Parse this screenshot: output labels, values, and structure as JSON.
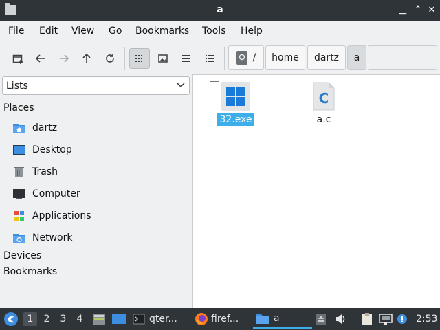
{
  "window": {
    "title": "a"
  },
  "menu": [
    "File",
    "Edit",
    "View",
    "Go",
    "Bookmarks",
    "Tools",
    "Help"
  ],
  "breadcrumb": {
    "root": "/",
    "items": [
      "home",
      "dartz",
      "a"
    ]
  },
  "sidebar": {
    "selector": "Lists",
    "places_header": "Places",
    "places": [
      "dartz",
      "Desktop",
      "Trash",
      "Computer",
      "Applications",
      "Network"
    ],
    "devices_header": "Devices",
    "bookmarks_header": "Bookmarks"
  },
  "files": [
    {
      "name": "32.exe",
      "icon": "windows-executable-icon",
      "selected": true
    },
    {
      "name": "a.c",
      "icon": "c-source-file-icon",
      "selected": false
    }
  ],
  "taskbar": {
    "workspaces": [
      "1",
      "2",
      "3",
      "4"
    ],
    "tasks": [
      {
        "label": "qter...",
        "icon": "terminal-icon"
      },
      {
        "label": "firef...",
        "icon": "firefox-icon"
      },
      {
        "label": "a",
        "icon": "folder-icon"
      }
    ],
    "clock": "2:53"
  },
  "colors": {
    "accent": "#3daee9",
    "titlebar": "#2f3438",
    "folder": "#3d8ee0"
  }
}
